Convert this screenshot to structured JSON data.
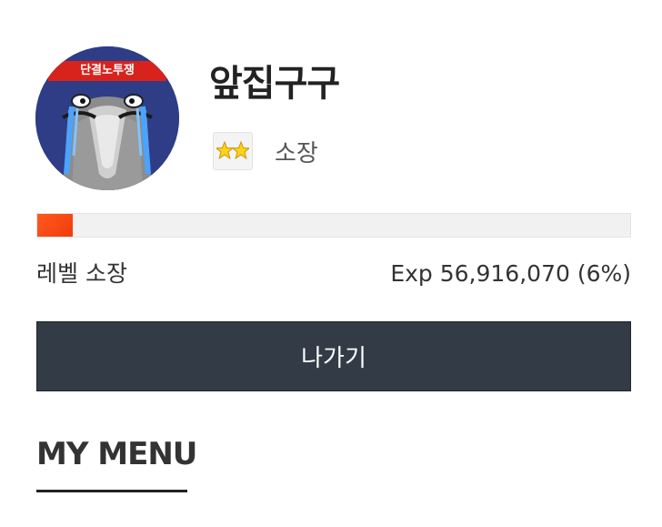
{
  "profile": {
    "username": "앞집구구",
    "avatar_banner_text": "단결노투쟁",
    "rank_icon": "two-stars-icon",
    "rank_label": "소장"
  },
  "experience": {
    "level_label": "레벨 소장",
    "exp_text": "Exp 56,916,070 (6%)",
    "progress_fraction": 0.06,
    "bar_color": "#f04a14"
  },
  "actions": {
    "logout_label": "나가기",
    "button_color": "#323b46"
  },
  "menu": {
    "heading": "MY MENU"
  }
}
